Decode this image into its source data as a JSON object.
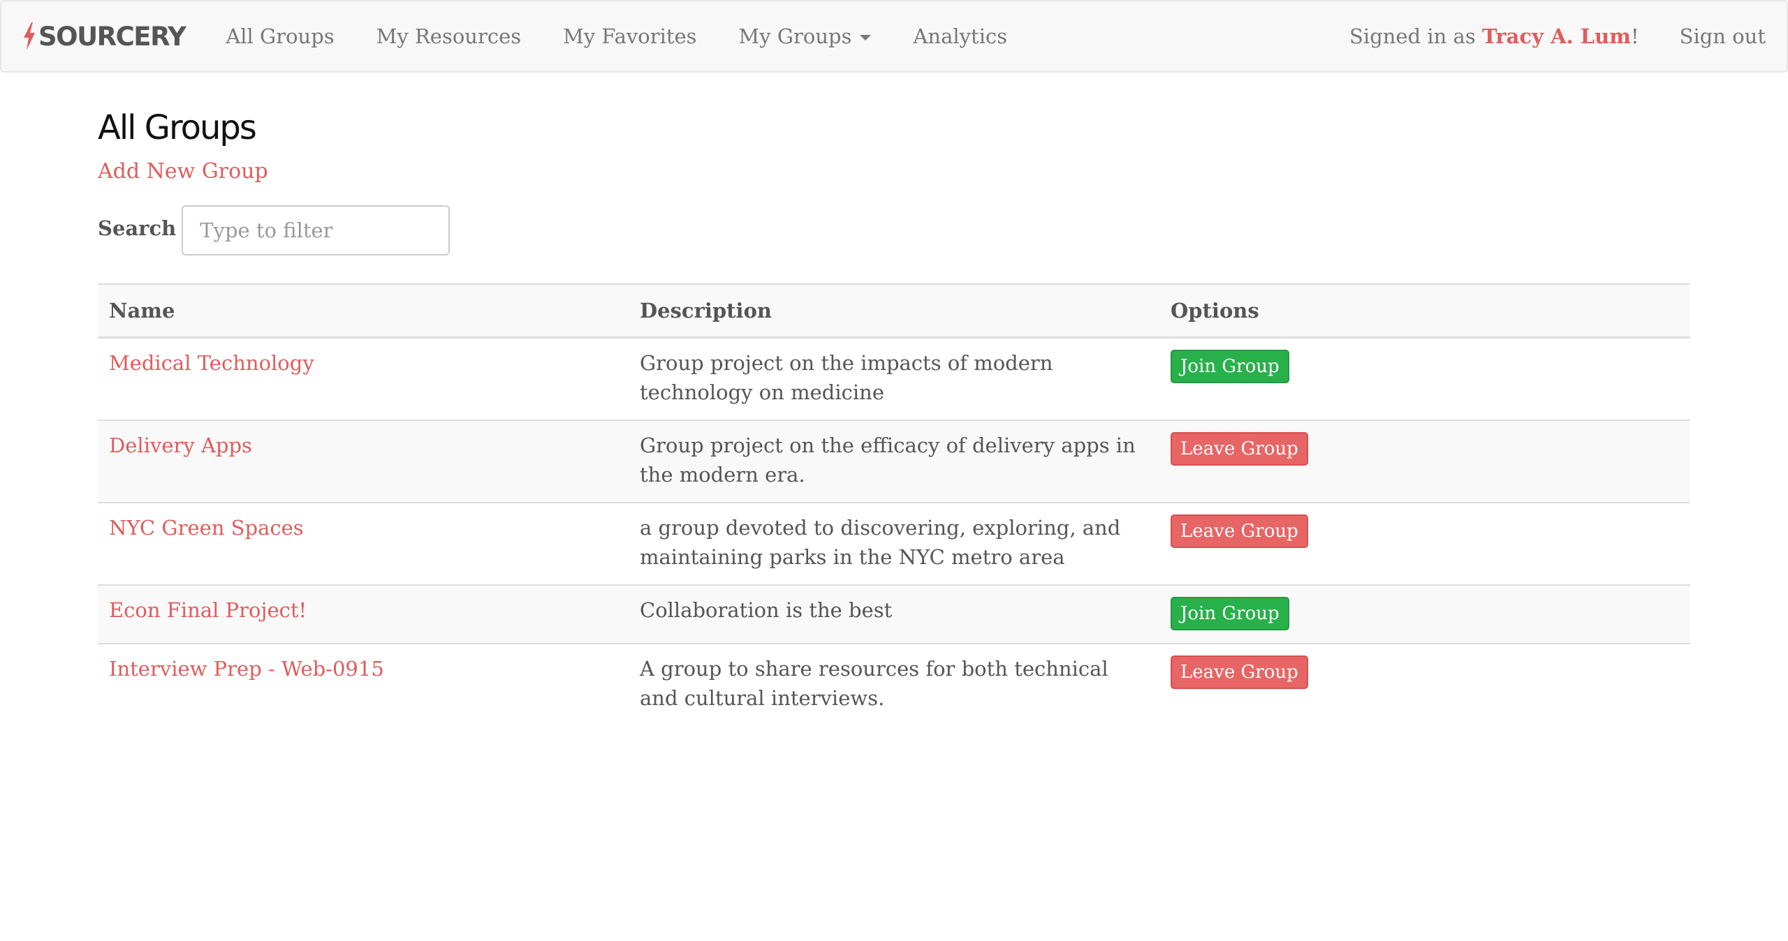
{
  "nav": {
    "brand": "SOURCERY",
    "links": [
      "All Groups",
      "My Resources",
      "My Favorites",
      "My Groups",
      "Analytics"
    ],
    "signed_in_prefix": "Signed in as ",
    "user_name": "Tracy A. Lum",
    "signed_in_suffix": "!",
    "sign_out": "Sign out"
  },
  "page": {
    "title": "All Groups",
    "add_link": "Add New Group",
    "search_label": "Search",
    "search_placeholder": "Type to filter"
  },
  "table": {
    "headers": [
      "Name",
      "Description",
      "Options"
    ],
    "rows": [
      {
        "name": "Medical Technology",
        "description": "Group project on the impacts of modern technology on medicine",
        "action": "Join Group",
        "action_type": "join"
      },
      {
        "name": "Delivery Apps",
        "description": "Group project on the efficacy of delivery apps in the modern era.",
        "action": "Leave Group",
        "action_type": "leave"
      },
      {
        "name": "NYC Green Spaces",
        "description": "a group devoted to discovering, exploring, and maintaining parks in the NYC metro area",
        "action": "Leave Group",
        "action_type": "leave"
      },
      {
        "name": "Econ Final Project!",
        "description": "Collaboration is the best",
        "action": "Join Group",
        "action_type": "join"
      },
      {
        "name": "Interview Prep - Web-0915",
        "description": "A group to share resources for both technical and cultural interviews.",
        "action": "Leave Group",
        "action_type": "leave"
      }
    ]
  },
  "colors": {
    "accent": "#e05c5c",
    "join": "#28b04b",
    "leave": "#e86565"
  }
}
